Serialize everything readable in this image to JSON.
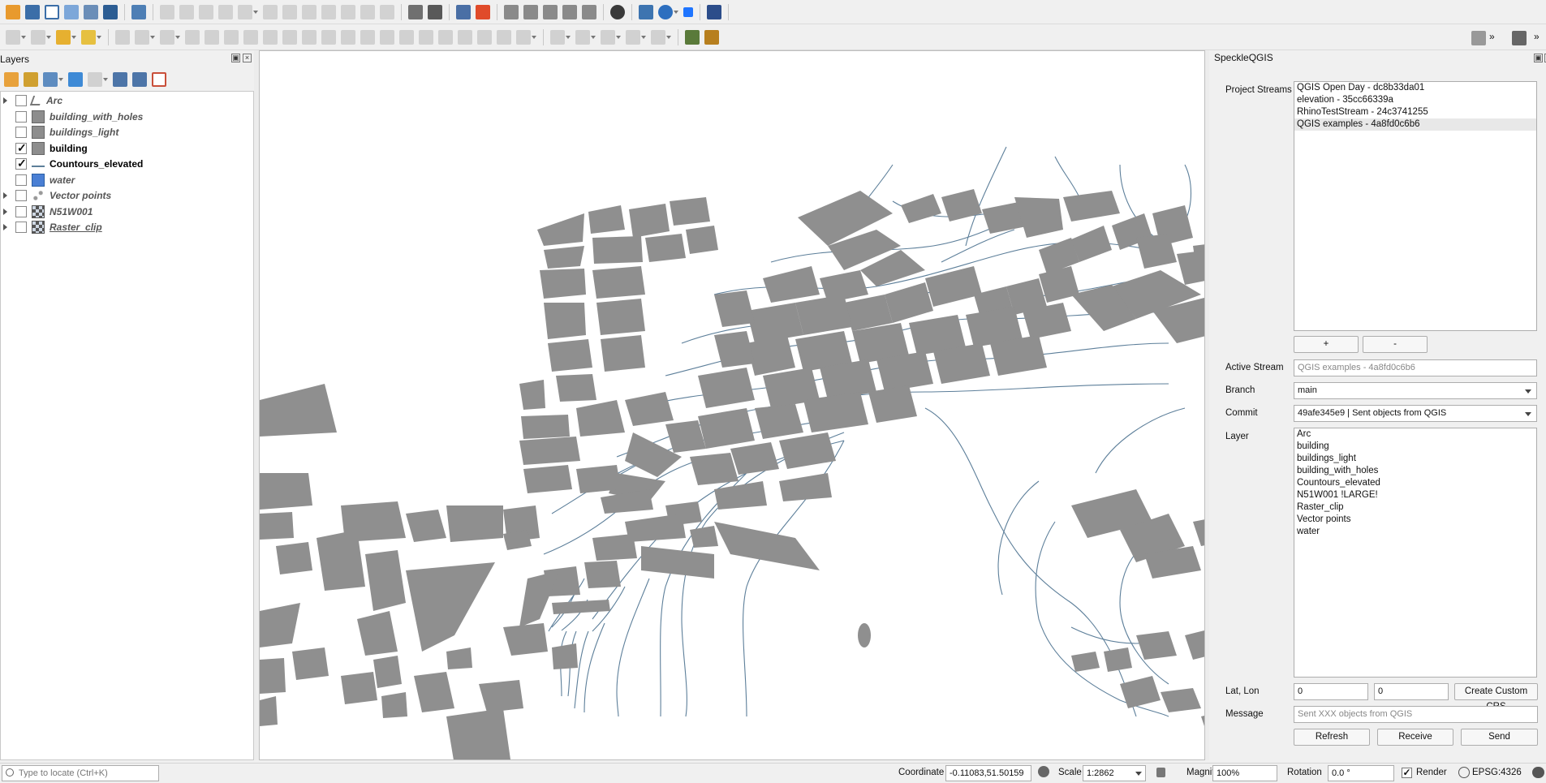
{
  "layers_panel": {
    "title": "Layers",
    "layers": [
      {
        "name": "Arc",
        "checked": false,
        "visible_style": "inactive",
        "icon": "line-geometry-icon",
        "expandable": true
      },
      {
        "name": "building_with_holes",
        "checked": false,
        "visible_style": "inactive",
        "icon": "polygon-gray-icon",
        "expandable": false
      },
      {
        "name": "buildings_light",
        "checked": false,
        "visible_style": "inactive",
        "icon": "polygon-gray-icon",
        "expandable": false
      },
      {
        "name": "building",
        "checked": true,
        "visible_style": "active",
        "icon": "polygon-gray-icon",
        "expandable": false
      },
      {
        "name": "Countours_elevated",
        "checked": true,
        "visible_style": "active",
        "icon": "line-blue-icon",
        "expandable": false
      },
      {
        "name": "water",
        "checked": false,
        "visible_style": "inactive",
        "icon": "polygon-blue-icon",
        "expandable": false
      },
      {
        "name": "Vector points",
        "checked": false,
        "visible_style": "inactive",
        "icon": "points-icon",
        "expandable": true
      },
      {
        "name": "N51W001",
        "checked": false,
        "visible_style": "inactive",
        "icon": "raster-icon",
        "expandable": true
      },
      {
        "name": "Raster_clip",
        "checked": false,
        "visible_style": "inactive",
        "icon": "raster-icon",
        "expandable": true
      }
    ]
  },
  "speckle": {
    "title": "SpeckleQGIS",
    "project_streams_label": "Project Streams",
    "streams": [
      "QGIS Open Day - dc8b33da01",
      "elevation - 35cc66339a",
      "RhinoTestStream - 24c3741255",
      "QGIS examples - 4a8fd0c6b6"
    ],
    "selected_stream_index": 3,
    "add_label": "+",
    "remove_label": "-",
    "active_stream_label": "Active Stream",
    "active_stream_value": "QGIS examples - 4a8fd0c6b6",
    "branch_label": "Branch",
    "branch_value": "main",
    "commit_label": "Commit",
    "commit_value": "49afe345e9 | Sent objects from QGIS",
    "layer_label": "Layer",
    "layer_items": [
      "Arc",
      "building",
      "buildings_light",
      "building_with_holes",
      "Countours_elevated",
      "N51W001 !LARGE!",
      "Raster_clip",
      "Vector points",
      "water"
    ],
    "latlon_label": "Lat, Lon",
    "lat_value": "0",
    "lon_value": "0",
    "custom_crs_label": "Create Custom CRS",
    "message_label": "Message",
    "message_placeholder": "Sent XXX objects from QGIS",
    "refresh_label": "Refresh",
    "receive_label": "Receive",
    "send_label": "Send"
  },
  "status_bar": {
    "locate_placeholder": "Type to locate (Ctrl+K)",
    "coordinate_label": "Coordinate",
    "coordinate_value": "-0.11083,51.50159",
    "scale_label": "Scale",
    "scale_value": "1:2862",
    "magnifier_label": "Magnifier",
    "magnifier_value": "100%",
    "rotation_label": "Rotation",
    "rotation_value": "0.0 °",
    "render_label": "Render",
    "render_checked": true,
    "crs_value": "EPSG:4326"
  },
  "colors": {
    "building_fill": "#8f8f8f",
    "contour_stroke": "#5d7f9a",
    "water_fill": "#4a7fd4"
  }
}
